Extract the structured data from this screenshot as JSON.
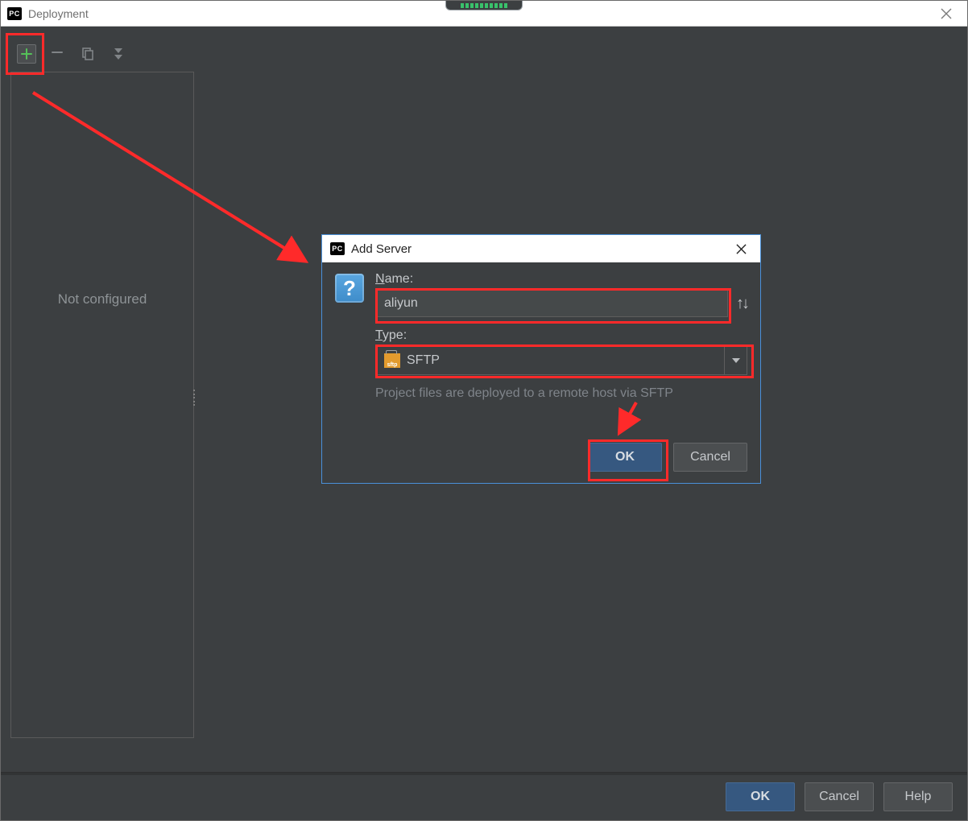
{
  "window": {
    "title": "Deployment",
    "ok_label": "OK",
    "cancel_label": "Cancel",
    "help_label": "Help"
  },
  "sidebar": {
    "placeholder": "Not configured"
  },
  "dialog": {
    "title": "Add Server",
    "name_label": "Name:",
    "name_letter": "N",
    "name_rest": "ame:",
    "name_value": "aliyun",
    "type_label": "Type:",
    "type_letter": "T",
    "type_rest": "ype:",
    "type_value": "SFTP",
    "hint": "Project files are deployed to a remote host via SFTP",
    "ok_label": "OK",
    "cancel_label": "Cancel"
  },
  "icons": {
    "pc": "PC",
    "sftp_tiny": "sftp"
  }
}
